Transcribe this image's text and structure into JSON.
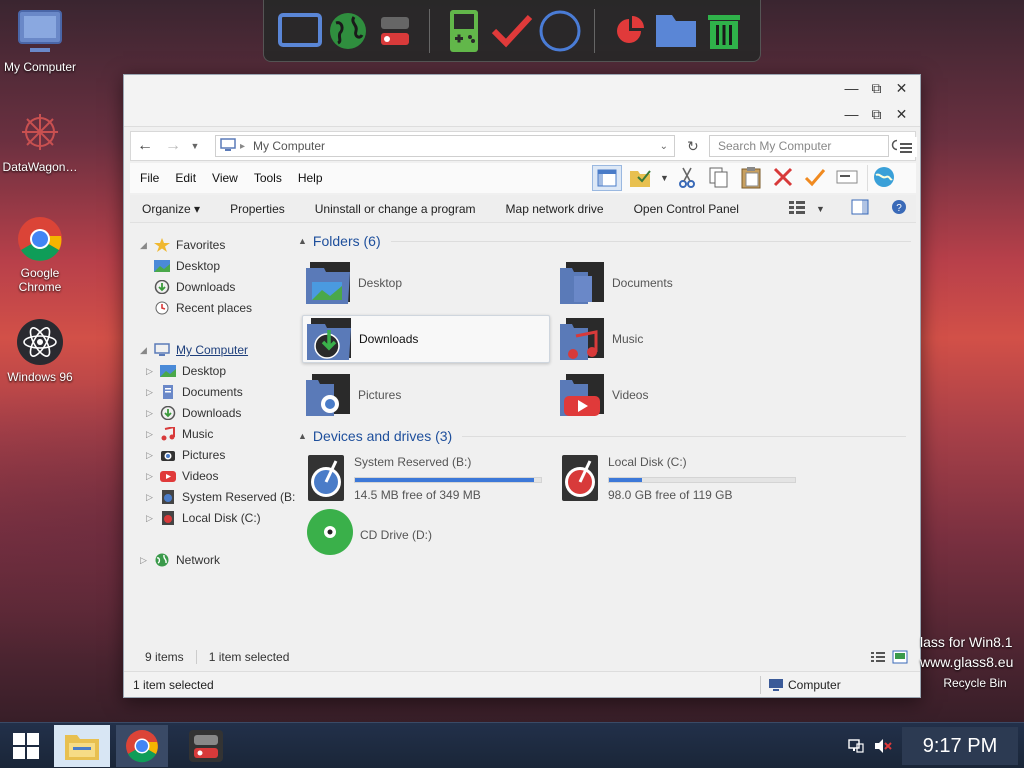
{
  "desktop": {
    "icons": [
      {
        "label": "My Computer",
        "icon": "monitor-icon"
      },
      {
        "label": "DataWagon…",
        "icon": "datawagon-icon"
      },
      {
        "label": "Google Chrome",
        "icon": "chrome-icon"
      },
      {
        "label": "Windows 96",
        "icon": "atom-icon"
      }
    ],
    "recycle_bin": "Recycle Bin",
    "glass_line1": "lass for Win8.1",
    "glass_line2": "www.glass8.eu"
  },
  "dock": {
    "items": [
      "computer-icon",
      "globe-icon",
      "toggle-icon",
      "gameboy-icon",
      "checkmark-icon",
      "circle-icon",
      "pie-icon",
      "folder-icon",
      "trash-icon"
    ]
  },
  "explorer": {
    "address": "My Computer",
    "search_placeholder": "Search My Computer",
    "menu": [
      "File",
      "Edit",
      "View",
      "Tools",
      "Help"
    ],
    "commands": [
      "Organize ▾",
      "Properties",
      "Uninstall or change a program",
      "Map network drive",
      "Open Control Panel"
    ],
    "nav": {
      "favorites": {
        "label": "Favorites",
        "items": [
          "Desktop",
          "Downloads",
          "Recent places"
        ]
      },
      "computer": {
        "label": "My Computer",
        "items": [
          "Desktop",
          "Documents",
          "Downloads",
          "Music",
          "Pictures",
          "Videos",
          "System Reserved (B:",
          "Local Disk (C:)"
        ]
      },
      "network": "Network"
    },
    "folders_header": "Folders (6)",
    "folders": [
      "Desktop",
      "Documents",
      "Downloads",
      "Music",
      "Pictures",
      "Videos"
    ],
    "selected_folder": "Downloads",
    "drives_header": "Devices and drives (3)",
    "drives": [
      {
        "name": "System Reserved (B:)",
        "free": "14.5 MB free of 349 MB",
        "used_fraction": 0.96
      },
      {
        "name": "Local Disk (C:)",
        "free": "98.0 GB free of 119 GB",
        "used_fraction": 0.18
      },
      {
        "name": "CD Drive (D:)"
      }
    ],
    "status_items": "9 items",
    "status_selected": "1 item selected",
    "footer_selected": "1 item selected",
    "footer_location": "Computer"
  },
  "taskbar": {
    "clock": "9:17 PM"
  },
  "colors": {
    "accent": "#3c78d8",
    "group_header": "#1e4f9c"
  }
}
